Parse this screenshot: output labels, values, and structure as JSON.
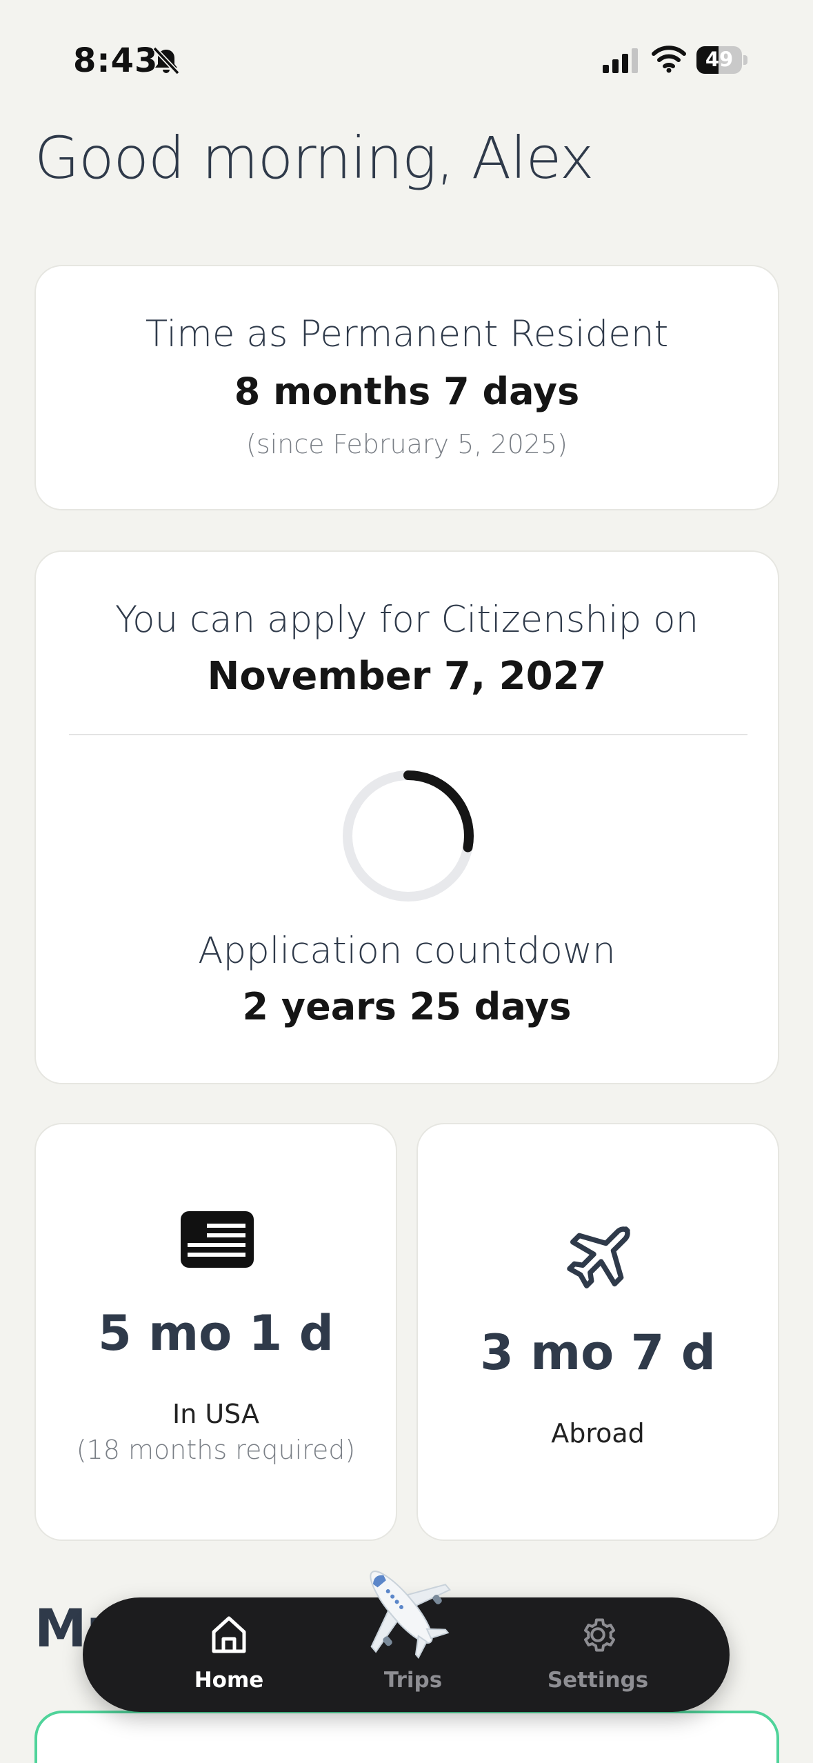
{
  "status": {
    "time": "8:43",
    "battery": "49",
    "battery_level": 0.49
  },
  "greeting": "Good morning, Alex",
  "pr_card": {
    "title": "Time as Permanent Resident",
    "value": "8 months 7 days",
    "since": "(since February 5, 2025)"
  },
  "citizenship_card": {
    "title": "You can apply for Citizenship on",
    "date": "November 7, 2027",
    "countdown_label": "Application countdown",
    "countdown_value": "2 years 25 days",
    "progress": 0.28
  },
  "usa_card": {
    "value": "5 mo 1 d",
    "label": "In USA",
    "requirement": "(18 months required)",
    "icon": "flag-icon"
  },
  "abroad_card": {
    "value": "3 mo 7 d",
    "label": "Abroad",
    "icon": "airplane-icon"
  },
  "section_peek": "Mu",
  "tabbar": {
    "active": "Home",
    "tabs": [
      {
        "label": "Home",
        "icon": "home-icon"
      },
      {
        "label": "Trips",
        "icon": "airplane-icon"
      },
      {
        "label": "Settings",
        "icon": "gear-icon"
      }
    ]
  },
  "colors": {
    "background": "#f3f3ef",
    "card": "#ffffff",
    "tabbar": "#1c1c1e",
    "accent_green": "#4fd39a",
    "text_dark": "#2f3a4a"
  }
}
